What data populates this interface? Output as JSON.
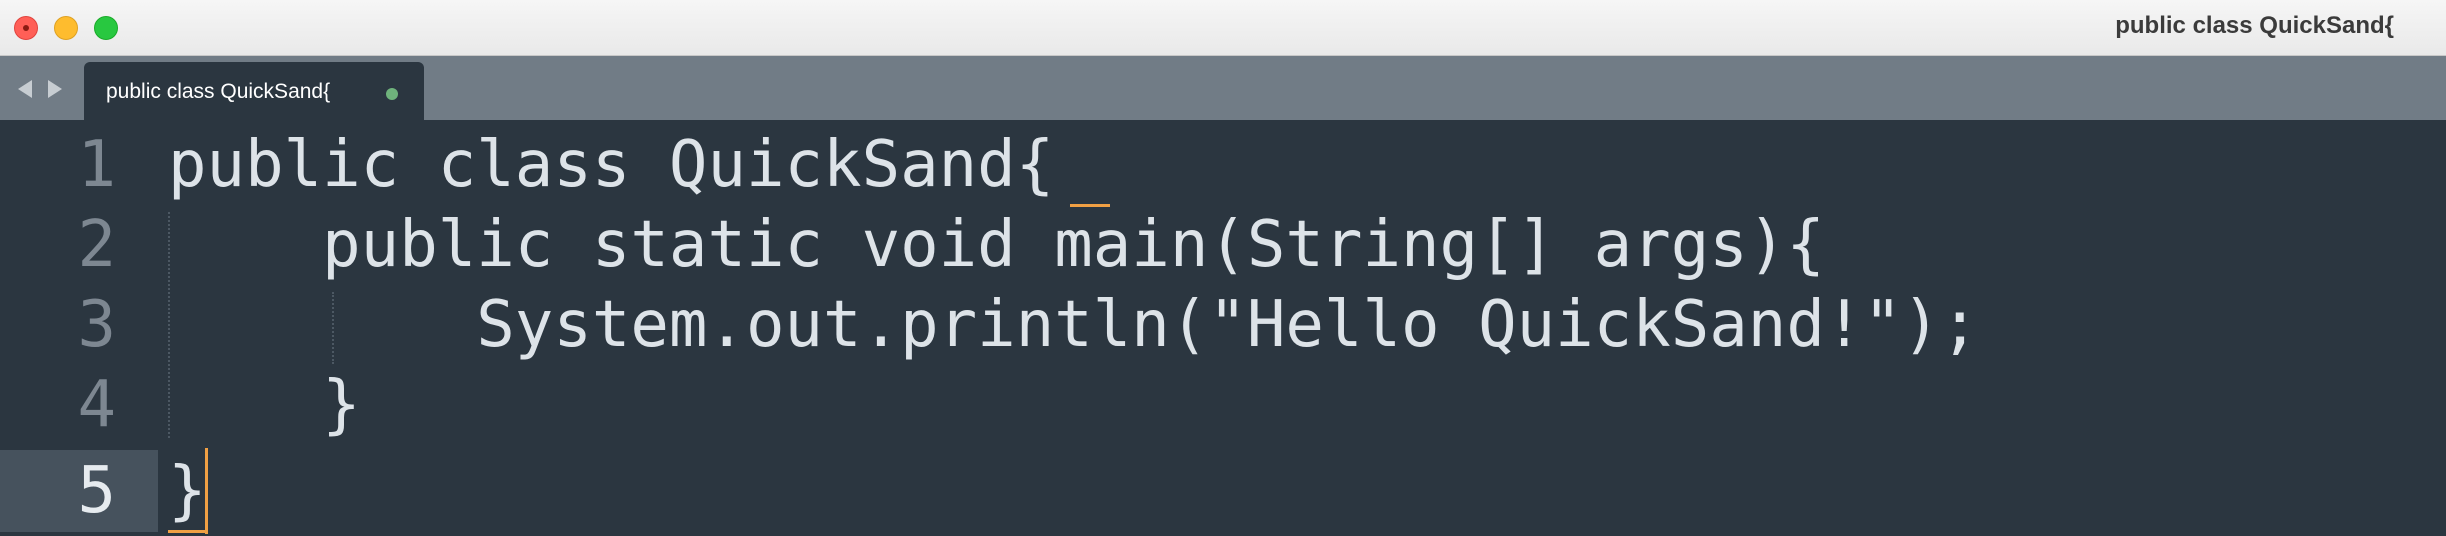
{
  "window": {
    "title": "public class QuickSand{"
  },
  "tab": {
    "label": "public class QuickSand{",
    "modified_indicator_color": "#6fb37c"
  },
  "editor": {
    "lines": [
      {
        "number": "1",
        "text": "public class QuickSand{"
      },
      {
        "number": "2",
        "text": "    public static void main(String[] args){"
      },
      {
        "number": "3",
        "text": "        System.out.println(\"Hello QuickSand!\");"
      },
      {
        "number": "4",
        "text": "    }"
      },
      {
        "number": "5",
        "text": "}"
      }
    ],
    "active_line": "5",
    "accent_color": "#f0a044"
  },
  "icons": {
    "close": "close-icon",
    "minimize": "minimize-icon",
    "maximize": "maximize-icon",
    "back": "chevron-left-icon",
    "forward": "chevron-right-icon"
  }
}
